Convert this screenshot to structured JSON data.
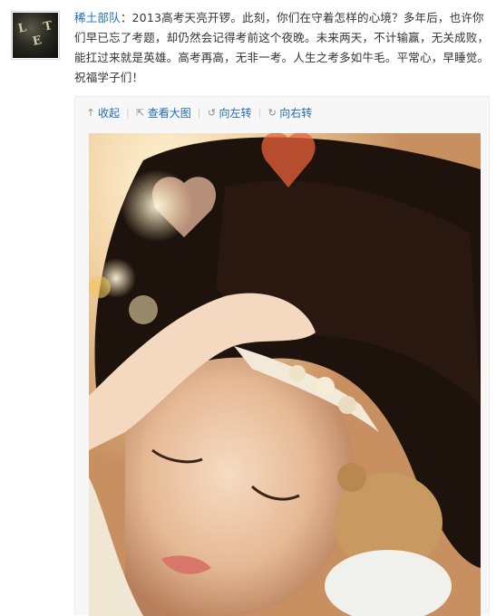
{
  "post": {
    "author": "稀土部队",
    "colon": "：",
    "text": "2013高考天亮开锣。此刻，你们在守着怎样的心境？多年后，也许你们早已忘了考题，却仍然会记得考前这个夜晚。未来两天，不计输赢，无关成败，能扛过来就是英雄。高考再高，无非一考。人生之考多如牛毛。平常心，早睡觉。祝福学子们！"
  },
  "toolbar": {
    "collapse_label": "收起",
    "view_large_label": "查看大图",
    "rotate_left_label": "向左转",
    "rotate_right_label": "向右转",
    "separator": "|"
  },
  "icons": {
    "collapse": "arrow-up-icon",
    "view_large": "external-link-icon",
    "rotate_left": "rotate-left-icon",
    "rotate_right": "rotate-right-icon"
  },
  "colors": {
    "link": "#1f6db7",
    "text": "#333333",
    "media_bg": "#f7f7f7"
  }
}
